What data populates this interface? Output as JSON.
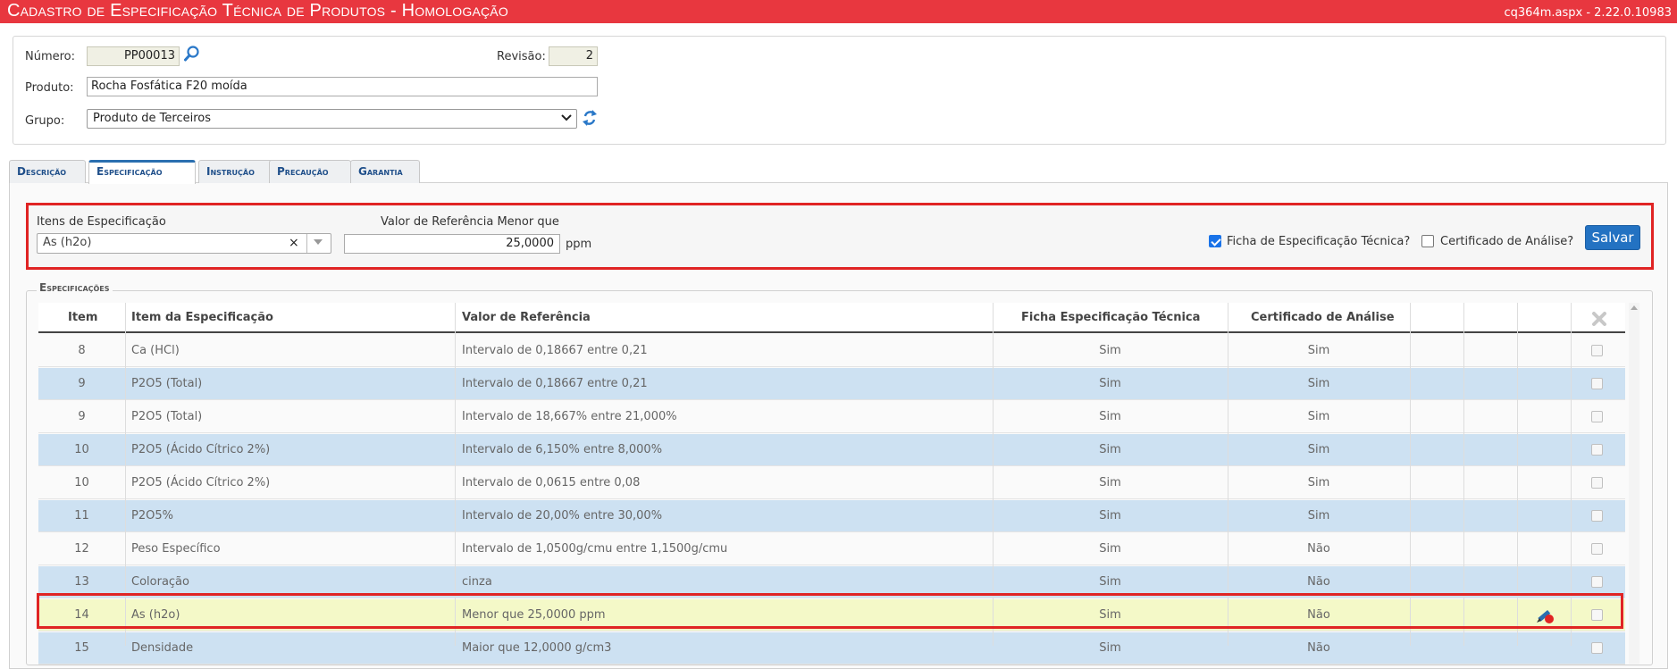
{
  "window": {
    "title": "Cadastro de Especificação Técnica de Produtos  - Homologação",
    "version": "cq364m.aspx - 2.22.0.10983"
  },
  "header": {
    "numero_label": "Número:",
    "numero_value": "PP00013",
    "revisao_label": "Revisão:",
    "revisao_value": "2",
    "produto_label": "Produto:",
    "produto_value": "Rocha Fosfática F20 moída",
    "grupo_label": "Grupo:",
    "grupo_value": "Produto de Terceiros"
  },
  "tabs": [
    {
      "label": "Descrição"
    },
    {
      "label": "Especificação"
    },
    {
      "label": "Instrução"
    },
    {
      "label": "Precaução"
    },
    {
      "label": "Garantia"
    }
  ],
  "filter": {
    "itens_label": "Itens de Especificação",
    "itens_value": "As (h2o)",
    "clear_symbol": "×",
    "valor_label": "Valor de Referência Menor que",
    "valor_value": "25,0000",
    "unit": "ppm",
    "ficha_label": "Ficha de Especificação Técnica?",
    "ficha_checked": true,
    "certificado_label": "Certificado de Análise?",
    "certificado_checked": false,
    "save_label": "Salvar"
  },
  "specs": {
    "legend": "Especificações",
    "columns": [
      "Item",
      "Item da Especificação",
      "Valor de Referência",
      "Ficha Especificação Técnica",
      "Certificado de Análise"
    ],
    "rows": [
      {
        "item": "8",
        "name": "Ca (HCl)",
        "ref": "Intervalo de 0,18667 entre 0,21",
        "ficha": "Sim",
        "cert": "Sim"
      },
      {
        "item": "9",
        "name": "P2O5 (Total)",
        "ref": "Intervalo de 0,18667 entre 0,21",
        "ficha": "Sim",
        "cert": "Sim"
      },
      {
        "item": "9",
        "name": "P2O5 (Total)",
        "ref": "Intervalo de 18,667% entre 21,000%",
        "ficha": "Sim",
        "cert": "Sim"
      },
      {
        "item": "10",
        "name": "P2O5 (Ácido Cítrico 2%)",
        "ref": "Intervalo de 6,150% entre 8,000%",
        "ficha": "Sim",
        "cert": "Sim"
      },
      {
        "item": "10",
        "name": "P2O5 (Ácido Cítrico 2%)",
        "ref": "Intervalo de 0,0615 entre 0,08",
        "ficha": "Sim",
        "cert": "Sim"
      },
      {
        "item": "11",
        "name": "P2O5%",
        "ref": "Intervalo de 20,00% entre 30,00%",
        "ficha": "Sim",
        "cert": "Sim"
      },
      {
        "item": "12",
        "name": "Peso Específico",
        "ref": "Intervalo de 1,0500g/cmu entre 1,1500g/cmu",
        "ficha": "Sim",
        "cert": "Não"
      },
      {
        "item": "13",
        "name": "Coloração",
        "ref": "cinza",
        "ficha": "Sim",
        "cert": "Não"
      },
      {
        "item": "14",
        "name": "As (h2o)",
        "ref": "Menor que 25,0000 ppm",
        "ficha": "Sim",
        "cert": "Não"
      },
      {
        "item": "15",
        "name": "Densidade",
        "ref": "Maior que 12,0000 g/cm3",
        "ficha": "Sim",
        "cert": "Não"
      }
    ]
  },
  "icons": {
    "search": "magnifier-icon",
    "refresh": "refresh-icon",
    "delete_all": "close-icon",
    "edit": "edit-icon"
  },
  "colors": {
    "titlebar": "#e8373f",
    "accent": "#2372c2",
    "row_alt": "#cde1f2",
    "row_selected": "#f4f9c8",
    "highlight": "#e02424"
  }
}
